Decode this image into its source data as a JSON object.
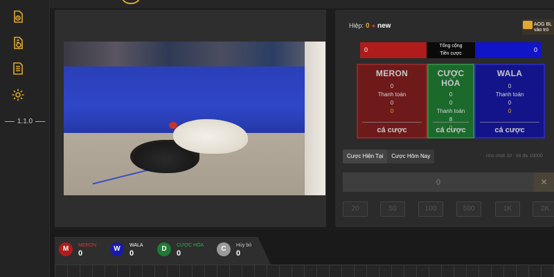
{
  "sidebar": {
    "icons": [
      "history-doc-icon",
      "money-doc-icon",
      "list-doc-icon",
      "gear-icon"
    ],
    "version": "1.1.0"
  },
  "round": {
    "label": "Hiệp:",
    "number": "0",
    "status": "new"
  },
  "promo": {
    "line1": "AOG BL",
    "line2": "vào trò"
  },
  "totals": {
    "meron": "0",
    "label_line1": "Tổng cộng",
    "label_line2": "Tiền cược",
    "wala": "0"
  },
  "boxes": {
    "meron": {
      "title": "MERON",
      "v1": "0",
      "payout_label": "Thanh toán",
      "v2": "0",
      "v3": "0",
      "bet": "cá cược"
    },
    "hoa": {
      "title": "CƯỢC HÒA",
      "v1": "0",
      "v1b": "0",
      "payout_label": "Thanh toán",
      "v2": "8",
      "v3": "0",
      "bet": "cá cược"
    },
    "wala": {
      "title": "WALA",
      "v1": "0",
      "payout_label": "Thanh toán",
      "v2": "0",
      "v3": "0",
      "bet": "cá cược"
    }
  },
  "tabs": [
    "Cược Hiện Tại",
    "Cược Hôm Nay"
  ],
  "hint": "nho nhất 10 · tối đa 10000",
  "amount": {
    "value": "0",
    "clear": "✕"
  },
  "chips": [
    "20",
    "50",
    "100",
    "500",
    "1K",
    "2K"
  ],
  "scores": [
    {
      "letter": "M",
      "label": "MERON",
      "value": "0",
      "color": "#b01c1c",
      "label_color": "#d83232"
    },
    {
      "letter": "W",
      "label": "WALA",
      "value": "0",
      "color": "#1a1aa8",
      "label_color": "#ffffff"
    },
    {
      "letter": "D",
      "label": "CƯỢC HÒA",
      "value": "0",
      "color": "#1f7a35",
      "label_color": "#2fb34e"
    },
    {
      "letter": "C",
      "label": "Hủy bỏ",
      "value": "0",
      "color": "#9a9a9a",
      "label_color": "#cccccc"
    }
  ]
}
